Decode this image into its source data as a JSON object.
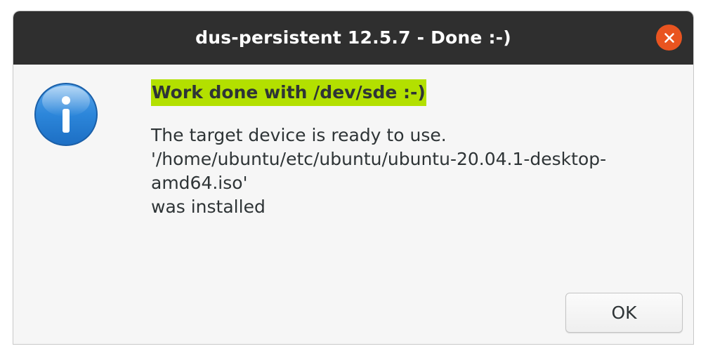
{
  "window": {
    "title": "dus-persistent 12.5.7 - Done :-)"
  },
  "titlebar": {
    "close_icon": "close-icon",
    "close_color": "#e95420",
    "background": "#2f2f2f"
  },
  "dialog": {
    "icon": "info-icon",
    "heading": "Work done with /dev/sde :-)",
    "heading_highlight_color": "#b3e000",
    "message_lines": [
      "The target device is ready to use.",
      "'/home/ubuntu/etc/ubuntu/ubuntu-20.04.1-desktop-",
      "amd64.iso'",
      "was installed"
    ],
    "ok_label": "OK"
  }
}
